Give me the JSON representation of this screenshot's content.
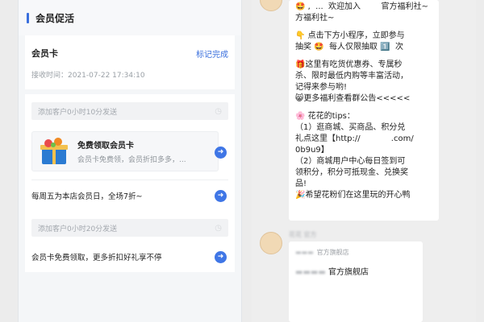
{
  "left": {
    "section_title": "会员促活",
    "card_title": "会员卡",
    "mark_done": "标记完成",
    "receive_time": "接收时间：2021-07-22 17:34:10",
    "schedule_1": "添加客户0小时10分发送",
    "miniprogram": {
      "title": "免费领取会员卡",
      "subtitle": "会员卡免费领，会员折扣多多，..."
    },
    "message_1": "每周五为本店会员日，全场7折~",
    "schedule_2": "添加客户0小时20分发送",
    "message_2": "会员卡免费领取，更多折扣好礼享不停"
  },
  "chat": {
    "lines": [
      {
        "text": "🤩 ,  ...  欢迎加入        官方福利社~"
      },
      {
        "text": "方福利社~"
      },
      {
        "text": ""
      },
      {
        "text": "👇 点击下方小程序，立即参与"
      },
      {
        "text": "抽奖 🤩  每人仅限抽取 1️⃣  次"
      },
      {
        "text": ""
      },
      {
        "text": "🎁这里有吃货优惠券、专属秒"
      },
      {
        "text": "杀、限时最低内购等丰富活动，"
      },
      {
        "text": "记得来参与哟!"
      },
      {
        "text": "😸更多福利查看群公告<<<<<"
      },
      {
        "text": ""
      },
      {
        "text": "🌸 花花的tips："
      },
      {
        "text": "（1）逛商城、买商品、积分兑"
      },
      {
        "text": "礼点这里【http://            .com/"
      },
      {
        "text": "0b9u9】"
      },
      {
        "text": "（2）商城用户中心每日签到可"
      },
      {
        "text": "领积分，积分可抵现金、兑换奖"
      },
      {
        "text": "品!"
      },
      {
        "text": "🎉希望花粉们在这里玩的开心鸭"
      }
    ],
    "sender_name": "花花 官方",
    "card_header": "官方旗舰店",
    "card_name": "官方旗舰店"
  },
  "colors": {
    "accent": "#3a6fdd"
  }
}
